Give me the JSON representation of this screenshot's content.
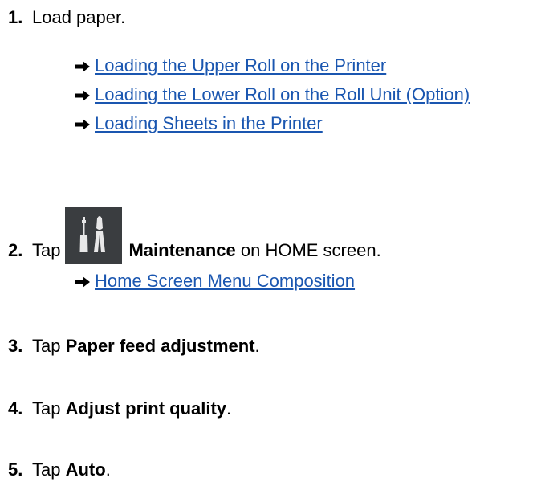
{
  "steps": [
    {
      "num": "1.",
      "text": "Load paper."
    },
    {
      "num": "2.",
      "pre": "Tap",
      "bold": "Maintenance",
      "post": " on HOME screen."
    },
    {
      "num": "3.",
      "pre": "Tap ",
      "bold": "Paper feed adjustment",
      "post": "."
    },
    {
      "num": "4.",
      "pre": "Tap ",
      "bold": "Adjust print quality",
      "post": "."
    },
    {
      "num": "5.",
      "pre": "Tap ",
      "bold": "Auto",
      "post": "."
    }
  ],
  "links": {
    "step1": [
      "Loading the Upper Roll on the Printer",
      "Loading the Lower Roll on the Roll Unit (Option)",
      "Loading Sheets in the Printer"
    ],
    "step2": [
      "Home Screen Menu Composition"
    ]
  },
  "icons": {
    "arrow": "right-arrow-icon",
    "maintenance": "maintenance-tools-icon"
  },
  "colors": {
    "link": "#1a56b0",
    "icon_bg": "#3a3d40"
  }
}
